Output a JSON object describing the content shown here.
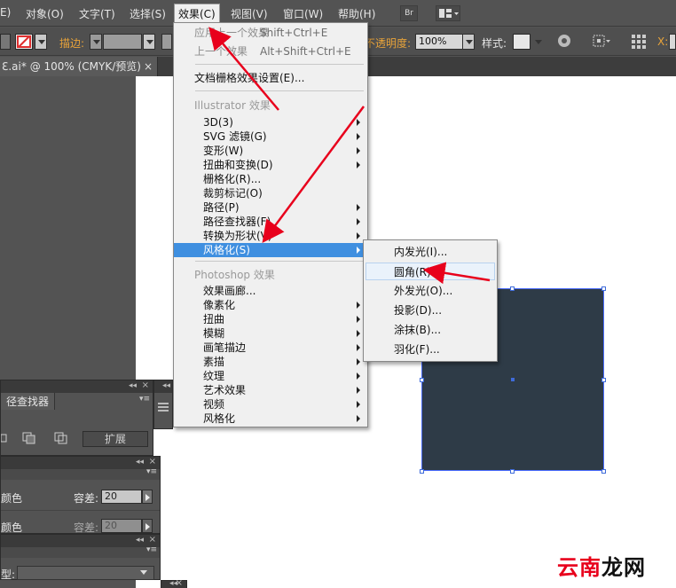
{
  "menubar": {
    "items": [
      "E)",
      "对象(O)",
      "文字(T)",
      "选择(S)",
      "效果(C)",
      "视图(V)",
      "窗口(W)",
      "帮助(H)"
    ],
    "br_label": "Br"
  },
  "ctrlbar": {
    "stroke_label": "描边:",
    "opacity_label": "不透明度:",
    "opacity_value": "100%",
    "style_label": "样式:",
    "x_label": "X:"
  },
  "tab": {
    "title": "ℇ.ai* @ 100% (CMYK/预览)",
    "close": "×"
  },
  "effect_menu": {
    "apply_last": "应用上一个效果",
    "apply_last_shortcut": "Shift+Ctrl+E",
    "last_effect": "上一个效果",
    "last_effect_shortcut": "Alt+Shift+Ctrl+E",
    "raster_settings": "文档栅格效果设置(E)...",
    "illustrator_header": "Illustrator 效果",
    "illustrator_items": [
      "3D(3)",
      "SVG 滤镜(G)",
      "变形(W)",
      "扭曲和变换(D)",
      "栅格化(R)...",
      "裁剪标记(O)",
      "路径(P)",
      "路径查找器(F)",
      "转换为形状(V)",
      "风格化(S)"
    ],
    "photoshop_header": "Photoshop 效果",
    "photoshop_items": [
      "效果画廊...",
      "像素化",
      "扭曲",
      "模糊",
      "画笔描边",
      "素描",
      "纹理",
      "艺术效果",
      "视频",
      "风格化"
    ]
  },
  "stylize_submenu": {
    "items": [
      "内发光(I)...",
      "圆角(R)...",
      "外发光(O)...",
      "投影(D)...",
      "涂抹(B)...",
      "羽化(F)..."
    ]
  },
  "pathfinder_panel": {
    "tab": "径查找器",
    "expand_button": "扩展"
  },
  "magic_panel": {
    "row1_label": "颜色",
    "row1_tol_label": "容差:",
    "row1_tol_value": "20",
    "row2_label": "颜色",
    "row2_tol_label": "容差:",
    "row2_tol_value": "20"
  },
  "bottom_panel": {
    "type_label": "型:"
  },
  "colors": {
    "accent": "#3f8fe0",
    "shape_fill": "#2e3b47",
    "arrow": "#e8001c"
  },
  "watermark": {
    "text1": "云南",
    "text2": "龙网"
  }
}
